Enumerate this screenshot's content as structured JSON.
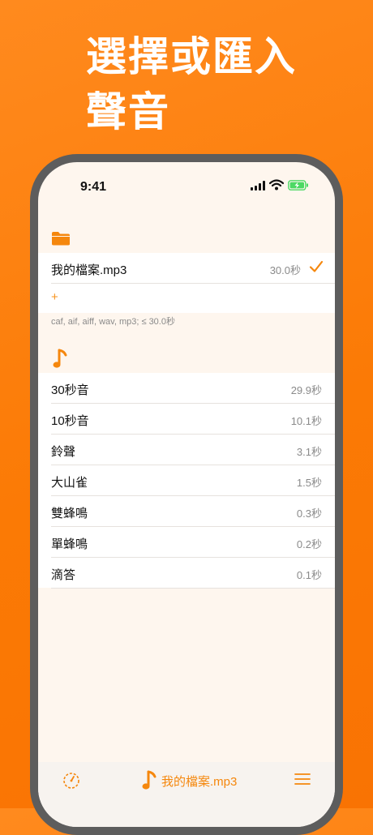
{
  "headline": {
    "line1": "選擇或匯入",
    "line2": "聲音"
  },
  "status_bar": {
    "time": "9:41"
  },
  "my_files": {
    "items": [
      {
        "name": "我的檔案.mp3",
        "duration": "30.0秒",
        "selected": true
      }
    ],
    "add_label": "+",
    "hint": "caf, aif, aiff, wav, mp3; ≤ 30.0秒"
  },
  "builtin_sounds": {
    "items": [
      {
        "name": "30秒音",
        "duration": "29.9秒"
      },
      {
        "name": "10秒音",
        "duration": "10.1秒"
      },
      {
        "name": "鈴聲",
        "duration": "3.1秒"
      },
      {
        "name": "大山雀",
        "duration": "1.5秒"
      },
      {
        "name": "雙蜂鳴",
        "duration": "0.3秒"
      },
      {
        "name": "單蜂鳴",
        "duration": "0.2秒"
      },
      {
        "name": "滴答",
        "duration": "0.1秒"
      }
    ]
  },
  "tab_bar": {
    "current_sound": "我的檔案.mp3"
  },
  "colors": {
    "accent": "#f5870d",
    "background": "#fb7a05"
  },
  "icons": [
    "folder-icon",
    "music-note-icon",
    "checkmark-icon",
    "timer-icon",
    "menu-icon",
    "signal-icon",
    "wifi-icon",
    "battery-icon"
  ]
}
